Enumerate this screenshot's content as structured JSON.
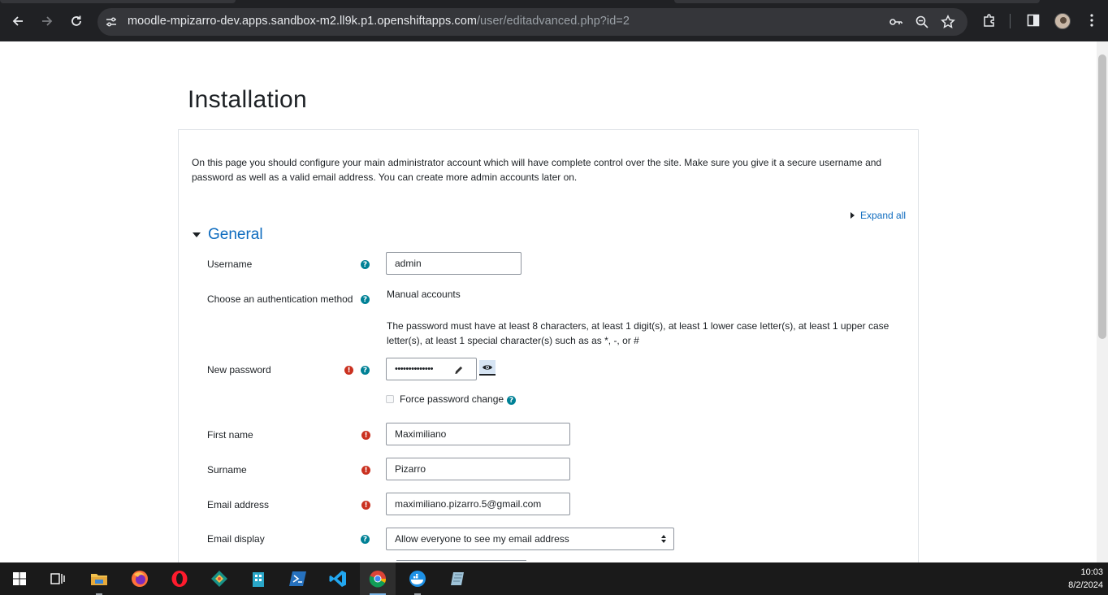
{
  "browser": {
    "url_host": "moodle-mpizarro-dev.apps.sandbox-m2.ll9k.p1.openshiftapps.com",
    "url_path": "/user/editadvanced.php?id=2"
  },
  "page": {
    "title": "Installation",
    "intro": "On this page you should configure your main administrator account which will have complete control over the site. Make sure you give it a secure username and password as well as a valid email address. You can create more admin accounts later on.",
    "expand_all": "Expand all",
    "section_title": "General"
  },
  "form": {
    "username_label": "Username",
    "username_value": "admin",
    "auth_label": "Choose an authentication method",
    "auth_value": "Manual accounts",
    "password_rules": "The password must have at least 8 characters, at least 1 digit(s), at least 1 lower case letter(s), at least 1 upper case letter(s), at least 1 special character(s) such as as *, -, or #",
    "password_label": "New password",
    "password_value": "••••••••••••••",
    "force_change_label": "Force password change",
    "firstname_label": "First name",
    "firstname_value": "Maximiliano",
    "surname_label": "Surname",
    "surname_value": "Pizarro",
    "email_label": "Email address",
    "email_value": "maximiliano.pizarro.5@gmail.com",
    "email_display_label": "Email display",
    "email_display_value": "Allow everyone to see my email address"
  },
  "taskbar": {
    "time": "10:03",
    "date": "8/2/2024"
  },
  "colors": {
    "link": "#0f6cbf",
    "help_icon": "#008196",
    "required_icon": "#ca3120",
    "browser_bar": "#202124",
    "taskbar": "#1a1a1a"
  }
}
